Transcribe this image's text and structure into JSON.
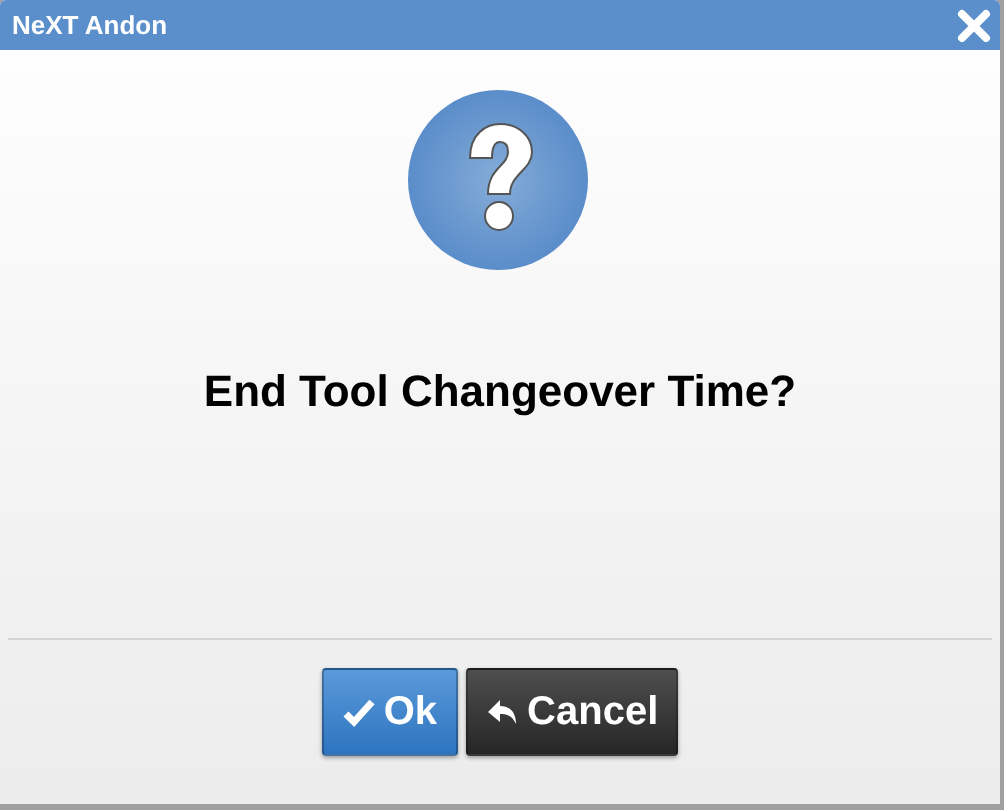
{
  "window": {
    "title": "NeXT Andon"
  },
  "message": "End Tool Changeover Time?",
  "buttons": [
    {
      "label": "Ok",
      "kind": "ok"
    },
    {
      "label": "Cancel",
      "kind": "cancel"
    }
  ]
}
